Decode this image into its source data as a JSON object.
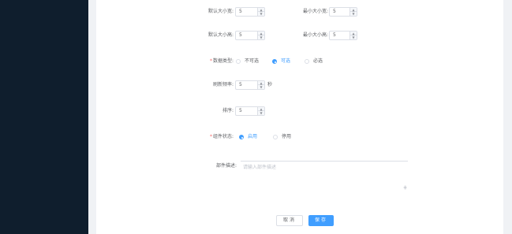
{
  "colors": {
    "sidebar": "#0f1e2d",
    "panel": "#ffffff",
    "background": "#f0f2f5",
    "primary": "#409eff",
    "required": "#f56c6c",
    "border": "#dcdfe6"
  },
  "form": {
    "default_size": {
      "label": "默认大小宽:",
      "value": "5"
    },
    "max_size": {
      "label": "最小大小宽:",
      "value": "5"
    },
    "default_rows": {
      "label": "默认大小高:",
      "value": "5"
    },
    "max_rows": {
      "label": "最小大小高:",
      "value": "5"
    },
    "data_type": {
      "label": "数据类型:",
      "options": [
        "不可选",
        "可选",
        "必选"
      ],
      "selected": "可选"
    },
    "refresh": {
      "label": "刷新频率:",
      "value": "5",
      "unit": "秒"
    },
    "sort": {
      "label": "排序:",
      "value": "5"
    },
    "enabled": {
      "label": "组件状态:",
      "options": [
        "启用",
        "停用"
      ],
      "selected": "启用"
    },
    "description": {
      "label": "部件描述:",
      "placeholder": "请输入部件描述"
    }
  },
  "icons": {
    "stepper_up": "chevron-up-icon",
    "stepper_down": "chevron-down-icon",
    "resize": "resize-handle-icon"
  },
  "actions": {
    "cancel": "取消",
    "confirm": "保存"
  }
}
